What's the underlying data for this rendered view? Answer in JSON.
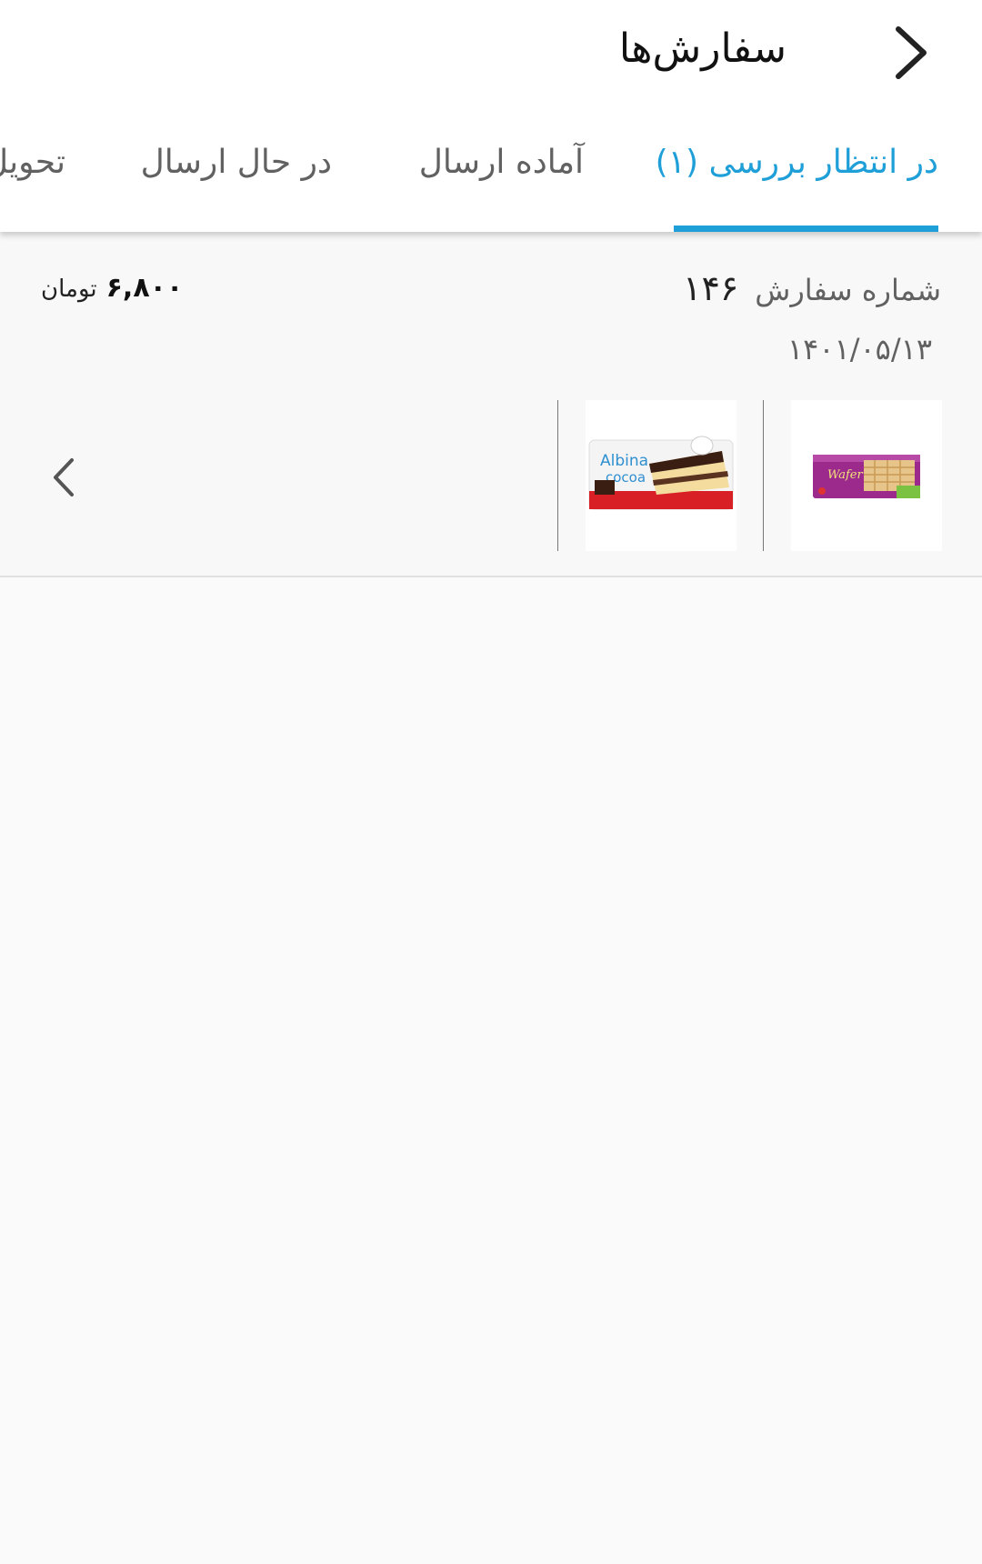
{
  "header": {
    "title": "سفارش‌ها",
    "back_icon": "chevron-right-icon"
  },
  "tabs": [
    {
      "label": "در انتظار بررسی (۱)",
      "active": true
    },
    {
      "label": "آماده ارسال",
      "active": false
    },
    {
      "label": "در حال ارسال",
      "active": false
    },
    {
      "label": "تحویل",
      "active": false
    }
  ],
  "colors": {
    "accent": "#1e9fd8",
    "tab_inactive": "#616161",
    "background": "#fafafa"
  },
  "order": {
    "number_label": "شماره سفارش",
    "number": "۱۴۶",
    "date": "۱۴۰۱/۰۵/۱۳",
    "price": "۶,۸۰۰",
    "currency": "تومان",
    "items": [
      {
        "name": "Wafer",
        "icon": "wafer-product-image"
      },
      {
        "name": "Albina cocoa",
        "icon": "albina-cocoa-product-image"
      }
    ],
    "more_icon": "chevron-left-icon"
  }
}
